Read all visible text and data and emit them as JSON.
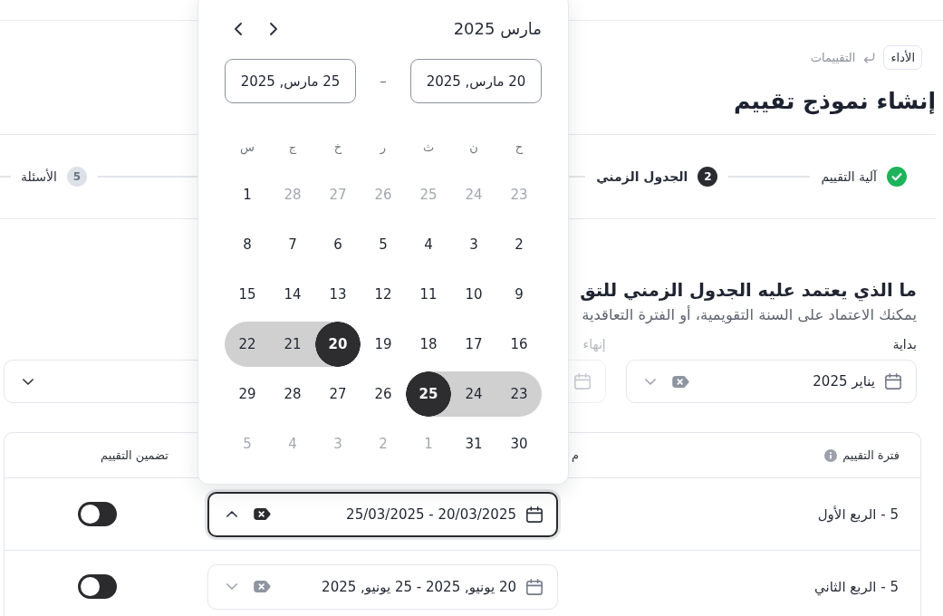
{
  "breadcrumb": [
    {
      "label": "الأداء",
      "kind": "chip"
    },
    {
      "label": "التقييمات",
      "kind": "link"
    }
  ],
  "title": "إنشاء نموذج تقييم",
  "stepper": [
    {
      "label": "آلية التقييم",
      "completed": true,
      "selected": false
    },
    {
      "number": "2",
      "label": "الجدول الزمني",
      "completed": false,
      "selected": true
    },
    {
      "number": "5",
      "label": "الأسئلة",
      "completed": false,
      "selected": false
    }
  ],
  "schedule": {
    "heading": "ما الذي يعتمد عليه الجدول الزمني للتق",
    "description": "يمكنك الاعتماد على السنة التقويمية، أو الفترة التعاقدية",
    "fields": [
      {
        "kind": "date",
        "label": "بداية",
        "value": "يناير 2025",
        "disabled": false
      },
      {
        "kind": "date",
        "label": "إنهاء",
        "disabled": true
      },
      {
        "kind": "select"
      }
    ]
  },
  "table": {
    "columns": [
      {
        "label": "فترة التقييم",
        "info": true
      },
      {
        "label": "م",
        "info": false
      },
      {
        "label": "تضمين التقييم",
        "info": false
      }
    ],
    "rows": [
      {
        "period": "5 - الربع الأول",
        "range": "20/03/2025 - 25/03/2025",
        "open": true,
        "included": false
      },
      {
        "period": "5 - الربع الثاني",
        "range": "20 يونيو, 2025 - 25 يونيو, 2025",
        "open": false,
        "included": false
      }
    ]
  },
  "date_picker": {
    "month": "مارس 2025",
    "start": "20 مارس, 2025",
    "separator": "–",
    "end": "25 مارس, 2025",
    "weekdays": [
      "ح",
      "ن",
      "ث",
      "ر",
      "خ",
      "ج",
      "س"
    ],
    "weeks": [
      [
        {
          "label": "23",
          "other_month": true,
          "selected": false,
          "in_range": false
        },
        {
          "label": "24",
          "other_month": true,
          "selected": false,
          "in_range": false
        },
        {
          "label": "25",
          "other_month": true,
          "selected": false,
          "in_range": false
        },
        {
          "label": "26",
          "other_month": true,
          "selected": false,
          "in_range": false
        },
        {
          "label": "27",
          "other_month": true,
          "selected": false,
          "in_range": false
        },
        {
          "label": "28",
          "other_month": true,
          "selected": false,
          "in_range": false
        },
        {
          "label": "1",
          "other_month": false,
          "selected": false,
          "in_range": false
        }
      ],
      [
        {
          "label": "2",
          "other_month": false,
          "selected": false,
          "in_range": false
        },
        {
          "label": "3",
          "other_month": false,
          "selected": false,
          "in_range": false
        },
        {
          "label": "4",
          "other_month": false,
          "selected": false,
          "in_range": false
        },
        {
          "label": "5",
          "other_month": false,
          "selected": false,
          "in_range": false
        },
        {
          "label": "6",
          "other_month": false,
          "selected": false,
          "in_range": false
        },
        {
          "label": "7",
          "other_month": false,
          "selected": false,
          "in_range": false
        },
        {
          "label": "8",
          "other_month": false,
          "selected": false,
          "in_range": false
        }
      ],
      [
        {
          "label": "9",
          "other_month": false,
          "selected": false,
          "in_range": false
        },
        {
          "label": "10",
          "other_month": false,
          "selected": false,
          "in_range": false
        },
        {
          "label": "11",
          "other_month": false,
          "selected": false,
          "in_range": false
        },
        {
          "label": "12",
          "other_month": false,
          "selected": false,
          "in_range": false
        },
        {
          "label": "13",
          "other_month": false,
          "selected": false,
          "in_range": false
        },
        {
          "label": "14",
          "other_month": false,
          "selected": false,
          "in_range": false
        },
        {
          "label": "15",
          "other_month": false,
          "selected": false,
          "in_range": false
        }
      ],
      [
        {
          "label": "16",
          "other_month": false,
          "selected": false,
          "in_range": false
        },
        {
          "label": "17",
          "other_month": false,
          "selected": false,
          "in_range": false
        },
        {
          "label": "18",
          "other_month": false,
          "selected": false,
          "in_range": false
        },
        {
          "label": "19",
          "other_month": false,
          "selected": false,
          "in_range": false
        },
        {
          "label": "20",
          "other_month": false,
          "selected": true,
          "in_range": false
        },
        {
          "label": "21",
          "other_month": false,
          "selected": false,
          "in_range": true
        },
        {
          "label": "22",
          "other_month": false,
          "selected": false,
          "in_range": true
        }
      ],
      [
        {
          "label": "23",
          "other_month": false,
          "selected": false,
          "in_range": true
        },
        {
          "label": "24",
          "other_month": false,
          "selected": false,
          "in_range": true
        },
        {
          "label": "25",
          "other_month": false,
          "selected": true,
          "in_range": false
        },
        {
          "label": "26",
          "other_month": false,
          "selected": false,
          "in_range": false
        },
        {
          "label": "27",
          "other_month": false,
          "selected": false,
          "in_range": false
        },
        {
          "label": "28",
          "other_month": false,
          "selected": false,
          "in_range": false
        },
        {
          "label": "29",
          "other_month": false,
          "selected": false,
          "in_range": false
        }
      ],
      [
        {
          "label": "30",
          "other_month": false,
          "selected": false,
          "in_range": false
        },
        {
          "label": "31",
          "other_month": false,
          "selected": false,
          "in_range": false
        },
        {
          "label": "1",
          "other_month": true,
          "selected": false,
          "in_range": false
        },
        {
          "label": "2",
          "other_month": true,
          "selected": false,
          "in_range": false
        },
        {
          "label": "3",
          "other_month": true,
          "selected": false,
          "in_range": false
        },
        {
          "label": "4",
          "other_month": true,
          "selected": false,
          "in_range": false
        },
        {
          "label": "5",
          "other_month": true,
          "selected": false,
          "in_range": false
        }
      ]
    ]
  }
}
